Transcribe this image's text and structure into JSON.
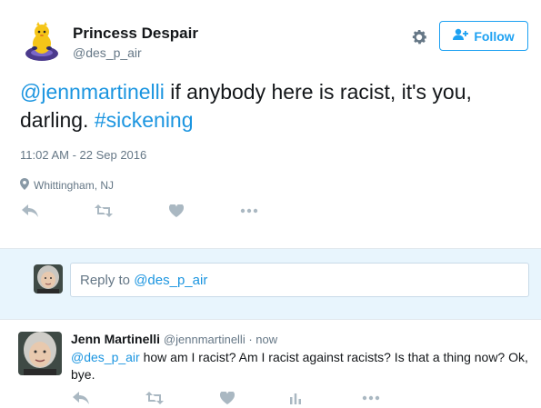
{
  "main_tweet": {
    "author_name": "Princess Despair",
    "author_handle": "@des_p_air",
    "follow_label": "Follow",
    "text_mention": "@jennmartinelli",
    "text_body": " if anybody here is racist, it's you, darling. ",
    "text_hashtag": "#sickening",
    "timestamp": "11:02 AM - 22 Sep 2016",
    "location": "Whittingham, NJ"
  },
  "reply_box": {
    "prefix": "Reply to ",
    "mention": "@des_p_air"
  },
  "reply_tweet": {
    "author_name": "Jenn Martinelli",
    "author_handle": "@jennmartinelli",
    "separator": " · ",
    "time": "now",
    "text_mention": "@des_p_air",
    "text_body": " how am I racist? Am I racist against racists? Is that a thing now? Ok, bye."
  },
  "icons": {
    "settings": "gear-icon",
    "follow": "add-user-icon",
    "location": "map-pin-icon",
    "reply": "reply-icon",
    "retweet": "retweet-icon",
    "like": "heart-icon",
    "more": "more-icon",
    "analytics": "analytics-icon"
  },
  "colors": {
    "accent": "#1da1f2",
    "link": "#1b95e0",
    "muted": "#657786",
    "reply_bg": "#e8f5fd",
    "action_icons": "#aab8c2"
  }
}
